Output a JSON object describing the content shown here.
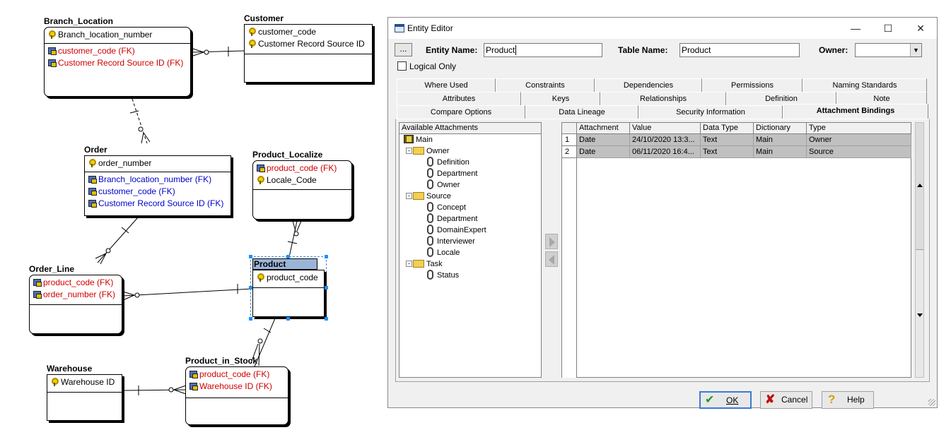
{
  "erd": {
    "branch_location": {
      "title": "Branch_Location",
      "pk": [
        "Branch_location_number"
      ],
      "attrs": [
        "customer_code (FK)",
        "Customer Record Source ID (FK)"
      ]
    },
    "customer": {
      "title": "Customer",
      "pk": [
        "customer_code",
        "Customer Record Source ID"
      ]
    },
    "order": {
      "title": "Order",
      "pk": [
        "order_number"
      ],
      "attrs": [
        "Branch_location_number (FK)",
        "customer_code (FK)",
        "Customer Record Source ID (FK)"
      ]
    },
    "product_localize": {
      "title": "Product_Localize",
      "pk": [
        "product_code (FK)",
        "Locale_Code"
      ]
    },
    "order_line": {
      "title": "Order_Line",
      "pk": [
        "product_code (FK)",
        "order_number (FK)"
      ]
    },
    "product": {
      "title": "Product",
      "pk": [
        "product_code"
      ]
    },
    "warehouse": {
      "title": "Warehouse",
      "pk": [
        "Warehouse ID"
      ]
    },
    "product_in_stock": {
      "title": "Product_in_Stock",
      "pk": [
        "product_code (FK)",
        "Warehouse ID (FK)"
      ]
    }
  },
  "editor": {
    "title": "Entity Editor",
    "ellipsis": "...",
    "entity_name_label": "Entity Name:",
    "entity_name_value": "Product",
    "table_name_label": "Table Name:",
    "table_name_value": "Product",
    "owner_label": "Owner:",
    "owner_value": "",
    "logical_only": "Logical Only",
    "tabs_row1": [
      "Where Used",
      "Constraints",
      "Dependencies",
      "Permissions",
      "Naming Standards"
    ],
    "tabs_row2": [
      "Attributes",
      "Keys",
      "Relationships",
      "Definition",
      "Note"
    ],
    "tabs_row3": [
      "Compare Options",
      "Data Lineage",
      "Security Information",
      "Attachment Bindings"
    ],
    "available_header": "Available Attachments",
    "tree": {
      "main": "Main",
      "owner": "Owner",
      "owner_children": [
        "Definition",
        "Department",
        "Owner"
      ],
      "source": "Source",
      "source_children": [
        "Concept",
        "Department",
        "DomainExpert",
        "Interviewer",
        "Locale"
      ],
      "task": "Task",
      "task_children": [
        "Status"
      ]
    },
    "grid_headers": [
      "Attachment",
      "Value",
      "Data Type",
      "Dictionary",
      "Type"
    ],
    "grid_rows": [
      {
        "num": "1",
        "attachment": "Date",
        "value": "24/10/2020 13:3...",
        "data_type": "Text",
        "dictionary": "Main",
        "type": "Owner"
      },
      {
        "num": "2",
        "attachment": "Date",
        "value": "06/11/2020 16:4...",
        "data_type": "Text",
        "dictionary": "Main",
        "type": "Source"
      }
    ],
    "ok_label": "OK",
    "cancel_label": "Cancel",
    "help_label": "Help"
  }
}
